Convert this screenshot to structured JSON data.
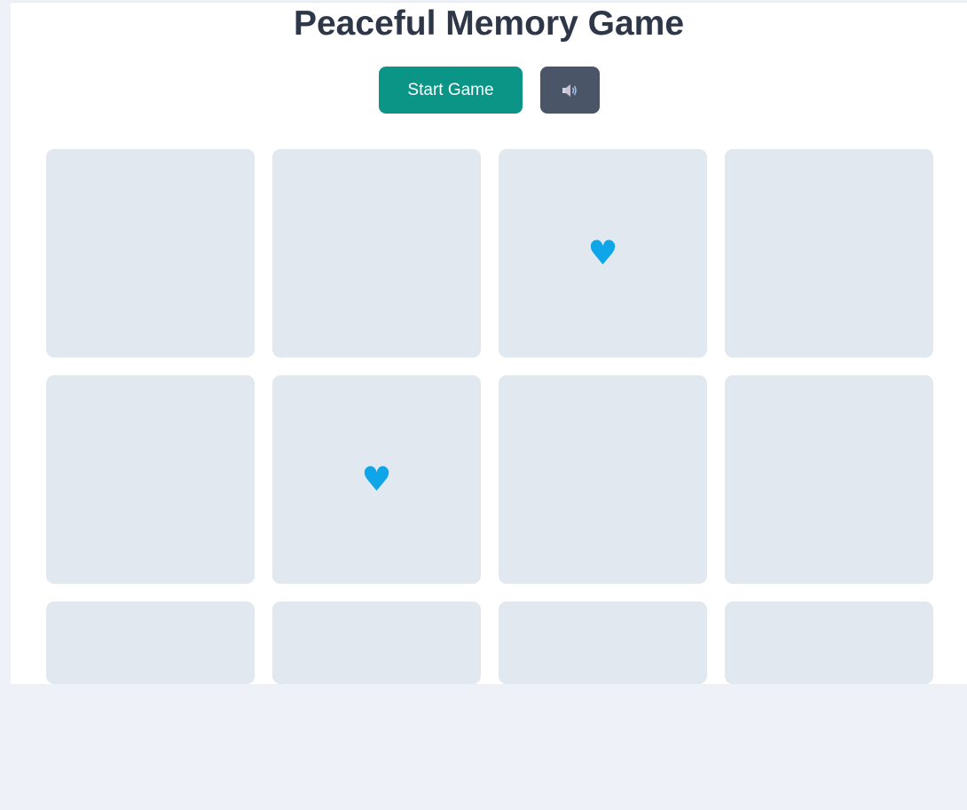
{
  "game": {
    "title": "Peaceful Memory Game",
    "start_label": "Start Game",
    "sound_icon": "speaker-icon"
  },
  "colors": {
    "start_button": "#0b9586",
    "sound_button": "#4a5568",
    "card_back": "#e2e8f0",
    "symbol": "#0ea5e9",
    "title": "#2d3748"
  },
  "cards": [
    {
      "symbol": ""
    },
    {
      "symbol": ""
    },
    {
      "symbol": "♥"
    },
    {
      "symbol": ""
    },
    {
      "symbol": ""
    },
    {
      "symbol": "♥"
    },
    {
      "symbol": ""
    },
    {
      "symbol": ""
    },
    {
      "symbol": ""
    },
    {
      "symbol": ""
    },
    {
      "symbol": ""
    },
    {
      "symbol": ""
    }
  ]
}
